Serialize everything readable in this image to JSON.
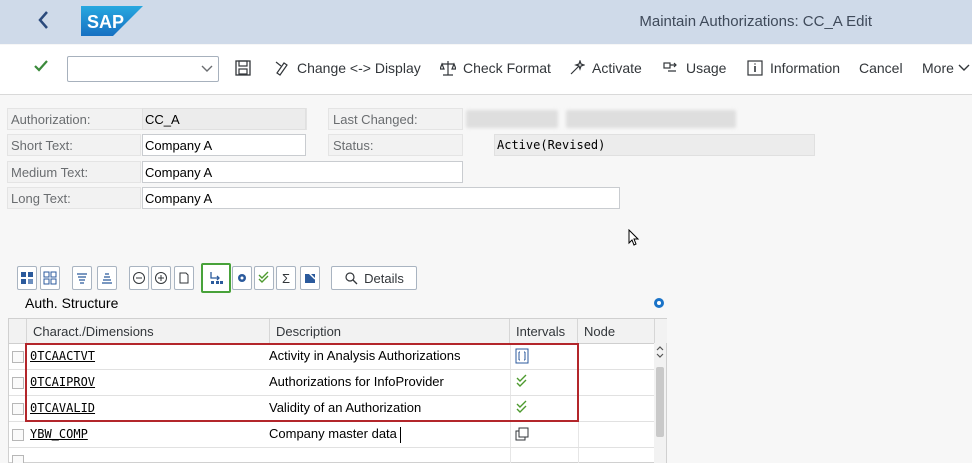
{
  "shell": {
    "logo_text": "SAP",
    "title": "Maintain Authorizations: CC_A Edit"
  },
  "toolbar": {
    "dropdown_value": "",
    "items": [
      {
        "label": "Change <-> Display",
        "icon": "change-display-icon"
      },
      {
        "label": "Check Format",
        "icon": "check-format-icon"
      },
      {
        "label": "Activate",
        "icon": "activate-icon"
      },
      {
        "label": "Usage",
        "icon": "usage-icon"
      },
      {
        "label": "Information",
        "icon": "information-icon"
      },
      {
        "label": "Cancel",
        "icon": ""
      },
      {
        "label": "More",
        "icon": "chevron-down-icon"
      }
    ]
  },
  "form": {
    "authorization_label": "Authorization:",
    "authorization_value": "CC_A",
    "short_text_label": "Short Text:",
    "short_text_value": "Company A",
    "medium_text_label": "Medium Text:",
    "medium_text_value": "Company A",
    "long_text_label": "Long Text:",
    "long_text_value": "Company A",
    "last_changed_label": "Last Changed:",
    "status_label": "Status:",
    "status_value": "Active(Revised)"
  },
  "auth_structure": {
    "details_label": "Details",
    "title": "Auth. Structure",
    "columns": [
      "Charact./Dimensions",
      "Description",
      "Intervals",
      "Node"
    ],
    "rows": [
      {
        "dimension": "0TCAACTVT",
        "description": "Activity in Analysis Authorizations",
        "intervals_icon": "intervals-icon"
      },
      {
        "dimension": "0TCAIPROV",
        "description": "Authorizations for InfoProvider",
        "intervals_icon": "double-check-icon"
      },
      {
        "dimension": "0TCAVALID",
        "description": "Validity of an Authorization",
        "intervals_icon": "double-check-icon"
      },
      {
        "dimension": "YBW_COMP",
        "description": "Company master data",
        "intervals_icon": "copy-icon"
      }
    ]
  },
  "colors": {
    "shell_bg": "#cfdae9",
    "highlight_red": "#b3262b",
    "highlight_green": "#48a23a",
    "sap_blue": "#1a73c8"
  }
}
